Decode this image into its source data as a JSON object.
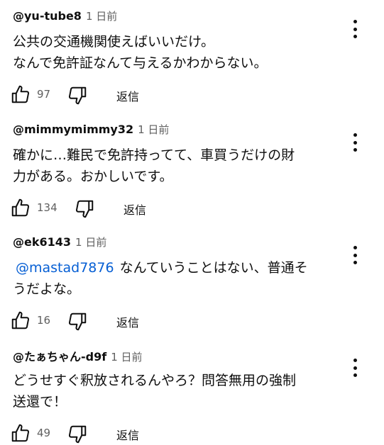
{
  "comments": [
    {
      "author": "@yu-tube8",
      "time": "1 日前",
      "mention": "",
      "text": "公共の交通機関使えばいいだけ。\nなんで免許証なんて与えるかわからない。",
      "likes": "97",
      "reply_label": "返信"
    },
    {
      "author": "@mimmymimmy32",
      "time": "1 日前",
      "mention": "",
      "text": "確かに…難民で免許持ってて、車買うだけの財\n力がある。おかしいです。",
      "likes": "134",
      "reply_label": "返信"
    },
    {
      "author": "@ek6143",
      "time": "1 日前",
      "mention": "@mastad7876",
      "text": "なんていうことはない、普通そ\nうだよな。",
      "likes": "16",
      "reply_label": "返信"
    },
    {
      "author": "@たぁちゃん-d9f",
      "time": "1 日前",
      "mention": "",
      "text": "どうせすぐ釈放されるんやろ？問答無用の強制\n送還で！",
      "likes": "49",
      "reply_label": "返信"
    }
  ],
  "icons": {
    "like": "thumbs-up-icon",
    "dislike": "thumbs-down-icon",
    "menu": "more-vertical-icon"
  },
  "colors": {
    "text": "#0f0f0f",
    "secondary": "#606060",
    "mention": "#065fd4"
  }
}
